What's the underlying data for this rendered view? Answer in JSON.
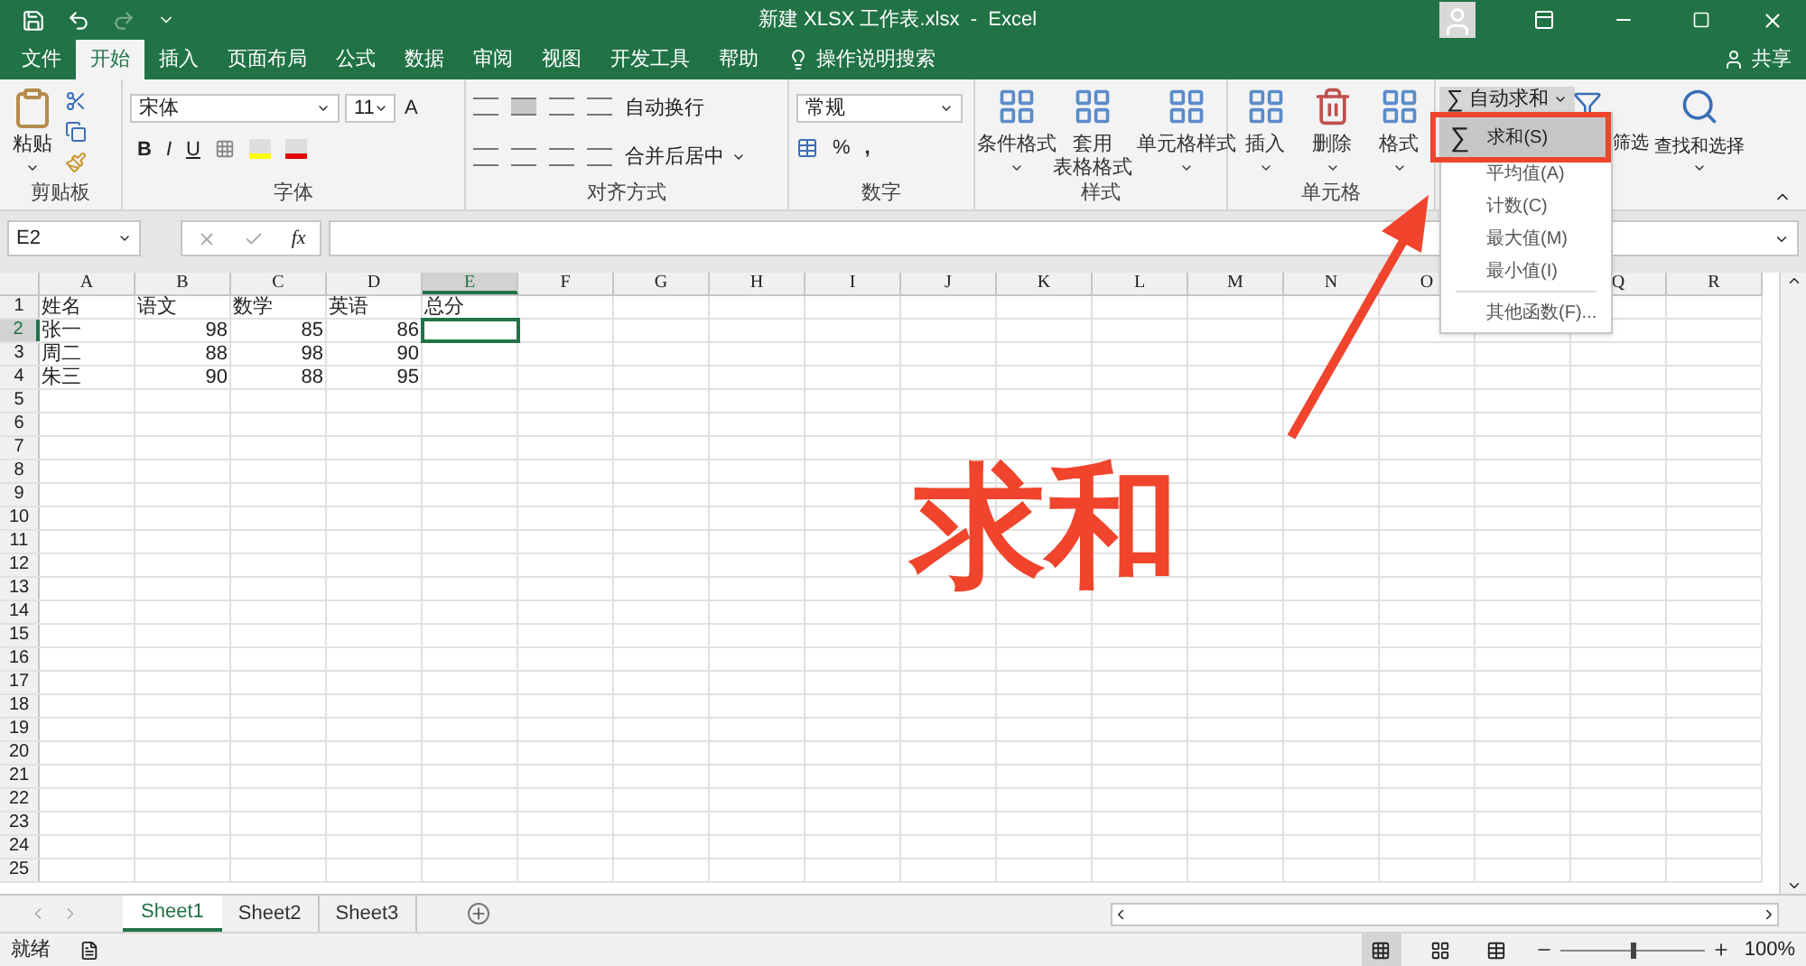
{
  "title_bar": {
    "title": "新建 XLSX 工作表.xlsx  -  Excel"
  },
  "ribbon_tabs": [
    {
      "label": "文件",
      "selected": false
    },
    {
      "label": "开始",
      "selected": true
    },
    {
      "label": "插入",
      "selected": false
    },
    {
      "label": "页面布局",
      "selected": false
    },
    {
      "label": "公式",
      "selected": false
    },
    {
      "label": "数据",
      "selected": false
    },
    {
      "label": "审阅",
      "selected": false
    },
    {
      "label": "视图",
      "selected": false
    },
    {
      "label": "开发工具",
      "selected": false
    },
    {
      "label": "帮助",
      "selected": false
    }
  ],
  "tell_me": {
    "placeholder": "操作说明搜索"
  },
  "share": "共享",
  "clipboard": {
    "paste": "粘贴",
    "label": "剪贴板"
  },
  "font": {
    "font_name": "宋体",
    "font_size": "11",
    "grow_font": "A",
    "bold": "B",
    "italic": "I",
    "underline": "U",
    "label": "字体"
  },
  "alignment": {
    "wrap_text": "自动换行",
    "merge_center": "合并后居中",
    "label": "对齐方式"
  },
  "number": {
    "format": "常规",
    "percent": "%",
    "comma": ",",
    "label": "数字"
  },
  "styles": {
    "buttons": [
      {
        "lines": [
          "条件格式"
        ]
      },
      {
        "lines": [
          "套用",
          "表格格式"
        ]
      },
      {
        "lines": [
          "单元格样式"
        ]
      }
    ],
    "label": "样式"
  },
  "cells": {
    "buttons": [
      "插入",
      "删除",
      "格式"
    ],
    "label": "单元格"
  },
  "editing": {
    "sigma": "∑",
    "autosum": "自动求和",
    "sort_filter": "筛选",
    "find_select": "查找和选择"
  },
  "autosum_menu": [
    {
      "sigma": "∑",
      "label": "求和(S)",
      "selected": true
    },
    {
      "label": "平均值(A)",
      "selected": false
    },
    {
      "label": "计数(C)",
      "selected": false
    },
    {
      "label": "最大值(M)",
      "selected": false
    },
    {
      "label": "最小值(I)",
      "selected": false
    },
    {
      "label": "其他函数(F)...",
      "selected": false
    }
  ],
  "formula_bar": {
    "name_box": "E2",
    "fx": "fx"
  },
  "columns": [
    {
      "label": "A",
      "selected": false
    },
    {
      "label": "B",
      "selected": false
    },
    {
      "label": "C",
      "selected": false
    },
    {
      "label": "D",
      "selected": false
    },
    {
      "label": "E",
      "selected": true
    },
    {
      "label": "F",
      "selected": false
    },
    {
      "label": "G",
      "selected": false
    },
    {
      "label": "H",
      "selected": false
    },
    {
      "label": "I",
      "selected": false
    },
    {
      "label": "J",
      "selected": false
    },
    {
      "label": "K",
      "selected": false
    },
    {
      "label": "L",
      "selected": false
    },
    {
      "label": "M",
      "selected": false
    },
    {
      "label": "N",
      "selected": false
    },
    {
      "label": "O",
      "selected": false
    }
  ],
  "columns_right": [
    {
      "label": "Q",
      "selected": false
    },
    {
      "label": "R",
      "selected": false
    }
  ],
  "rows": [
    {
      "header": "1",
      "selected": false,
      "cells": [
        {
          "text": "姓名",
          "kind": "text"
        },
        {
          "text": "语文",
          "kind": "text"
        },
        {
          "text": "数学",
          "kind": "text"
        },
        {
          "text": "英语",
          "kind": "text"
        },
        {
          "text": "总分",
          "kind": "text"
        }
      ]
    },
    {
      "header": "2",
      "selected": true,
      "cells": [
        {
          "text": "张一",
          "kind": "text"
        },
        {
          "text": "98",
          "kind": "number"
        },
        {
          "text": "85",
          "kind": "number"
        },
        {
          "text": "86",
          "kind": "number"
        }
      ]
    },
    {
      "header": "3",
      "selected": false,
      "cells": [
        {
          "text": "周二",
          "kind": "text"
        },
        {
          "text": "88",
          "kind": "number"
        },
        {
          "text": "98",
          "kind": "number"
        },
        {
          "text": "90",
          "kind": "number"
        }
      ]
    },
    {
      "header": "4",
      "selected": false,
      "cells": [
        {
          "text": "朱三",
          "kind": "text"
        },
        {
          "text": "90",
          "kind": "number"
        },
        {
          "text": "88",
          "kind": "number"
        },
        {
          "text": "95",
          "kind": "number"
        }
      ]
    },
    {
      "header": "5",
      "selected": false
    },
    {
      "header": "6",
      "selected": false
    },
    {
      "header": "7",
      "selected": false
    },
    {
      "header": "8",
      "selected": false
    },
    {
      "header": "9",
      "selected": false
    },
    {
      "header": "10",
      "selected": false
    },
    {
      "header": "11",
      "selected": false
    },
    {
      "header": "12",
      "selected": false
    },
    {
      "header": "13",
      "selected": false
    },
    {
      "header": "14",
      "selected": false
    },
    {
      "header": "15",
      "selected": false
    },
    {
      "header": "16",
      "selected": false
    },
    {
      "header": "17",
      "selected": false
    },
    {
      "header": "18",
      "selected": false
    },
    {
      "header": "19",
      "selected": false
    },
    {
      "header": "20",
      "selected": false
    },
    {
      "header": "21",
      "selected": false
    },
    {
      "header": "22",
      "selected": false
    },
    {
      "header": "23",
      "selected": false
    },
    {
      "header": "24",
      "selected": false
    },
    {
      "header": "25",
      "selected": false
    }
  ],
  "sheet_tabs": [
    {
      "label": "Sheet1",
      "selected": true
    },
    {
      "label": "Sheet2",
      "selected": false
    },
    {
      "label": "Sheet3",
      "selected": false
    }
  ],
  "status_bar": {
    "status": "就绪",
    "zoom": "100%",
    "zoom_slider": {
      "level": 0.5
    }
  },
  "annotation": {
    "text": "求和"
  }
}
